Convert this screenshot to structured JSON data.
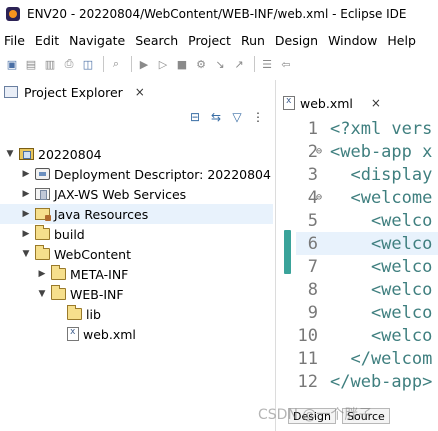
{
  "window": {
    "title": "ENV20 - 20220804/WebContent/WEB-INF/web.xml - Eclipse IDE"
  },
  "menu": [
    "File",
    "Edit",
    "Navigate",
    "Search",
    "Project",
    "Run",
    "Design",
    "Window",
    "Help"
  ],
  "toolbar": {
    "icons": [
      "new-icon",
      "save-icon",
      "save-all-icon",
      "print-icon",
      "open-type-icon",
      "search-icon",
      "debug-icon",
      "run-icon",
      "stop-icon",
      "external-tools-icon",
      "next-annotation-icon",
      "prev-annotation-icon",
      "pin-icon",
      "back-icon"
    ]
  },
  "project_explorer": {
    "title": "Project Explorer",
    "close_label": "×",
    "tool_icons": [
      "collapse-all-icon",
      "link-with-editor-icon",
      "filter-icon",
      "view-menu-icon"
    ],
    "tree": [
      {
        "label": "20220804",
        "expanded": true,
        "icon": "project"
      },
      {
        "label": "Deployment Descriptor: 20220804",
        "expanded": false,
        "icon": "desc"
      },
      {
        "label": "JAX-WS Web Services",
        "expanded": false,
        "icon": "ws"
      },
      {
        "label": "Java Resources",
        "expanded": false,
        "icon": "javares",
        "selected": true
      },
      {
        "label": "build",
        "expanded": false,
        "icon": "folder"
      },
      {
        "label": "WebContent",
        "expanded": true,
        "icon": "folder"
      },
      {
        "label": "META-INF",
        "expanded": false,
        "icon": "folder"
      },
      {
        "label": "WEB-INF",
        "expanded": true,
        "icon": "folder"
      },
      {
        "label": "lib",
        "expanded": null,
        "icon": "folder"
      },
      {
        "label": "web.xml",
        "expanded": null,
        "icon": "xml"
      }
    ]
  },
  "editor": {
    "tab_label": "web.xml",
    "close_label": "×",
    "lines": [
      {
        "num": "1",
        "fold": "",
        "text": "<?xml vers"
      },
      {
        "num": "2",
        "fold": "⊖",
        "text": "<web-app x"
      },
      {
        "num": "3",
        "fold": "",
        "text": "  <display"
      },
      {
        "num": "4",
        "fold": "⊖",
        "text": "  <welcome"
      },
      {
        "num": "5",
        "fold": "",
        "text": "    <welco"
      },
      {
        "num": "6",
        "fold": "",
        "text": "    <welco"
      },
      {
        "num": "7",
        "fold": "",
        "text": "    <welco"
      },
      {
        "num": "8",
        "fold": "",
        "text": "    <welco"
      },
      {
        "num": "9",
        "fold": "",
        "text": "    <welco"
      },
      {
        "num": "10",
        "fold": "",
        "text": "    <welco"
      },
      {
        "num": "11",
        "fold": "",
        "text": "  </welcom"
      },
      {
        "num": "12",
        "fold": "",
        "text": "</web-app>"
      }
    ],
    "current_line": 6
  },
  "bottom_tabs": [
    "Design",
    "Source"
  ],
  "watermark": "CSDN @一个胖子"
}
